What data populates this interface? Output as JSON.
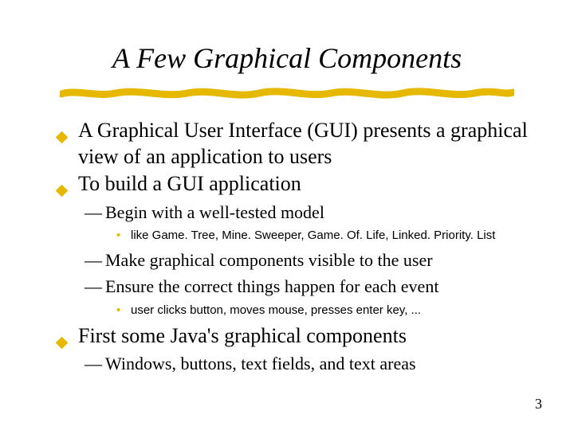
{
  "title": "A Few Graphical Components",
  "bullets": {
    "b1": "A Graphical User Interface (GUI) presents a graphical view of an application to users",
    "b2": "To build a GUI application",
    "b2s1": "Begin with a well-tested model",
    "b2s1d1": "like Game. Tree, Mine. Sweeper, Game. Of. Life, Linked. Priority. List",
    "b2s2": "Make graphical components visible to the user",
    "b2s3": "Ensure the correct things happen for each event",
    "b2s3d1": "user clicks button, moves mouse, presses enter key, ...",
    "b3": "First some Java's graphical components",
    "b3s1": "Windows, buttons, text fields, and text areas"
  },
  "page_number": "3"
}
